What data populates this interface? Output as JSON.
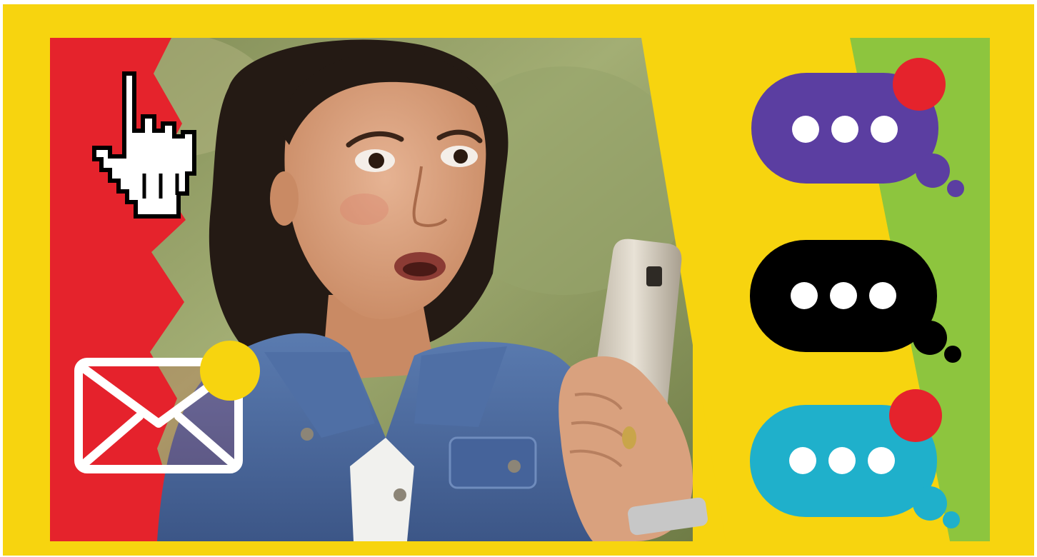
{
  "palette": {
    "frame_yellow": "#f7d40f",
    "accent_red": "#e5232c",
    "accent_green": "#8dc53e",
    "bubble_purple": "#5b3ea1",
    "bubble_black": "#000000",
    "bubble_teal": "#1fb0cb",
    "denim": "#4a6a9e",
    "skin": "#d9a17e",
    "hair": "#241a14"
  },
  "icons": [
    "hand-pointer-cursor-icon",
    "envelope-icon",
    "notification-dot-icon",
    "chat-bubble-icon",
    "typing-dots-icon"
  ],
  "bubbles": [
    {
      "color": "purple",
      "has_notification": true
    },
    {
      "color": "black",
      "has_notification": false
    },
    {
      "color": "teal",
      "has_notification": true
    }
  ]
}
